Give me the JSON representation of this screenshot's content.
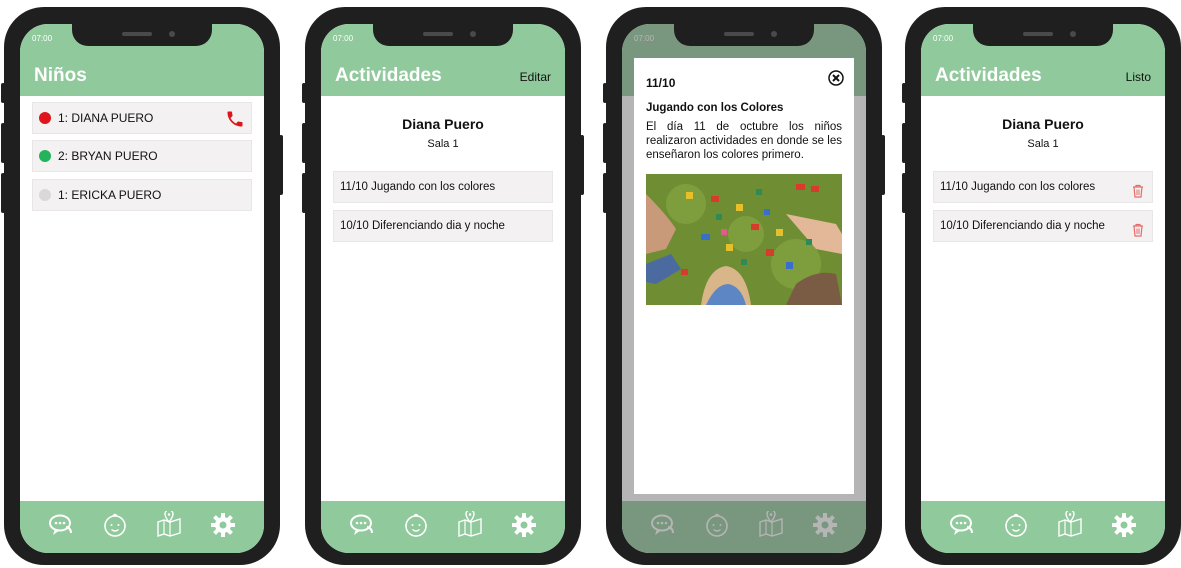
{
  "phones": [
    {
      "time": "07:00",
      "title": "Niños",
      "children": [
        {
          "label": "1: DIANA PUERO",
          "status_color": "#e0151b"
        },
        {
          "label": "2: BRYAN PUERO",
          "status_color": "#22b35c"
        },
        {
          "label": "1: ERICKA PUERO",
          "status_color": "#d9d9d9"
        }
      ],
      "call_icon": "phone-icon"
    },
    {
      "time": "07:00",
      "title": "Actividades",
      "action": "Editar",
      "child_name": "Diana Puero",
      "room": "Sala 1",
      "activities": [
        "11/10 Jugando con los colores",
        "10/10 Diferenciando dia y noche"
      ]
    },
    {
      "time": "07:00",
      "modal": {
        "date": "11/10",
        "title": "Jugando con los Colores",
        "description": "El día 11 de octubre los niños realizaron actividades en donde se les enseñaron los colores primero.",
        "close_icon": "close-circle-icon"
      }
    },
    {
      "time": "07:00",
      "title": "Actividades",
      "action": "Listo",
      "child_name": "Diana Puero",
      "room": "Sala 1",
      "activities": [
        "11/10 Jugando con los colores",
        "10/10 Diferenciando dia y noche"
      ],
      "delete_icon": "trash-icon"
    }
  ],
  "footer_icons": [
    "chat-icon",
    "child-face-icon",
    "map-location-icon",
    "gear-icon"
  ],
  "colors": {
    "accent": "#90c99b",
    "status_red": "#e0151b",
    "status_green": "#22b35c",
    "status_grey": "#d9d9d9",
    "trash_red": "#e86b6b"
  }
}
